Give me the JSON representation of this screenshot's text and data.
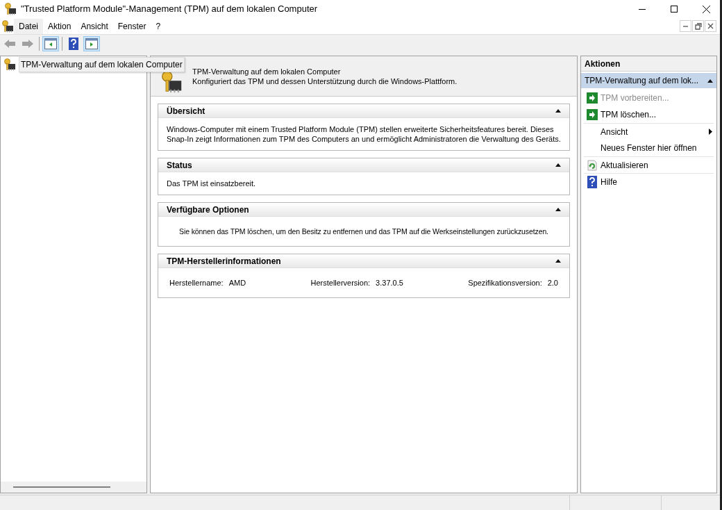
{
  "window": {
    "title": "\"Trusted Platform Module\"-Management (TPM) auf dem lokalen Computer"
  },
  "menu": [
    {
      "label": "Datei",
      "selected": true
    },
    {
      "label": "Aktion",
      "selected": false
    },
    {
      "label": "Ansicht",
      "selected": false
    },
    {
      "label": "Fenster",
      "selected": false
    },
    {
      "label": "?",
      "selected": false
    }
  ],
  "toolbar": [
    {
      "kind": "back",
      "disabled": true
    },
    {
      "kind": "forward",
      "disabled": true
    },
    {
      "kind": "separator"
    },
    {
      "kind": "tree-toggle",
      "pressed": true
    },
    {
      "kind": "separator"
    },
    {
      "kind": "help",
      "pressed": false
    },
    {
      "kind": "action-toggle",
      "pressed": true
    }
  ],
  "tree": {
    "items": [
      {
        "label": "TPM-Verwaltung auf dem lokalen Computer",
        "selected": true
      }
    ]
  },
  "header": {
    "title": "TPM-Verwaltung auf dem lokalen Computer",
    "description": "Konfiguriert das TPM und dessen Unterstützung durch die Windows-Plattform."
  },
  "sections": [
    {
      "title": "Übersicht",
      "expanded": true,
      "kind": "text",
      "text": "Windows-Computer mit einem Trusted Platform Module (TPM) stellen erweiterte Sicherheitsfeatures bereit. Dieses Snap-In zeigt Informationen zum TPM des Computers an und ermöglicht Administratoren die Verwaltung des Geräts."
    },
    {
      "title": "Status",
      "expanded": true,
      "kind": "text",
      "text": "Das TPM ist einsatzbereit."
    },
    {
      "title": "Verfügbare Optionen",
      "expanded": true,
      "kind": "centered",
      "text": "Sie können das TPM löschen, um den Besitz zu entfernen und das TPM auf die Werkseinstellungen zurückzusetzen."
    },
    {
      "title": "TPM-Herstellerinformationen",
      "expanded": true,
      "kind": "fields",
      "fields": [
        {
          "label": "Herstellername:",
          "value": "AMD"
        },
        {
          "label": "Herstellerversion:",
          "value": "3.37.0.5"
        },
        {
          "label": "Spezifikationsversion:",
          "value": "2.0"
        }
      ]
    }
  ],
  "actions": {
    "title": "Aktionen",
    "group": {
      "title": "TPM-Verwaltung auf dem lok...",
      "expanded": true
    },
    "items": [
      {
        "label": "TPM vorbereiten...",
        "kind": "run",
        "disabled": true,
        "divider": false
      },
      {
        "label": "TPM löschen...",
        "kind": "run",
        "disabled": false,
        "divider": false
      },
      {
        "label": "Ansicht",
        "kind": "submenu",
        "disabled": false,
        "divider": true
      },
      {
        "label": "Neues Fenster hier öffnen",
        "kind": "plain",
        "disabled": false,
        "divider": false
      },
      {
        "label": "Aktualisieren",
        "kind": "refresh",
        "disabled": false,
        "divider": true
      },
      {
        "label": "Hilfe",
        "kind": "help",
        "disabled": false,
        "divider": true
      }
    ]
  }
}
